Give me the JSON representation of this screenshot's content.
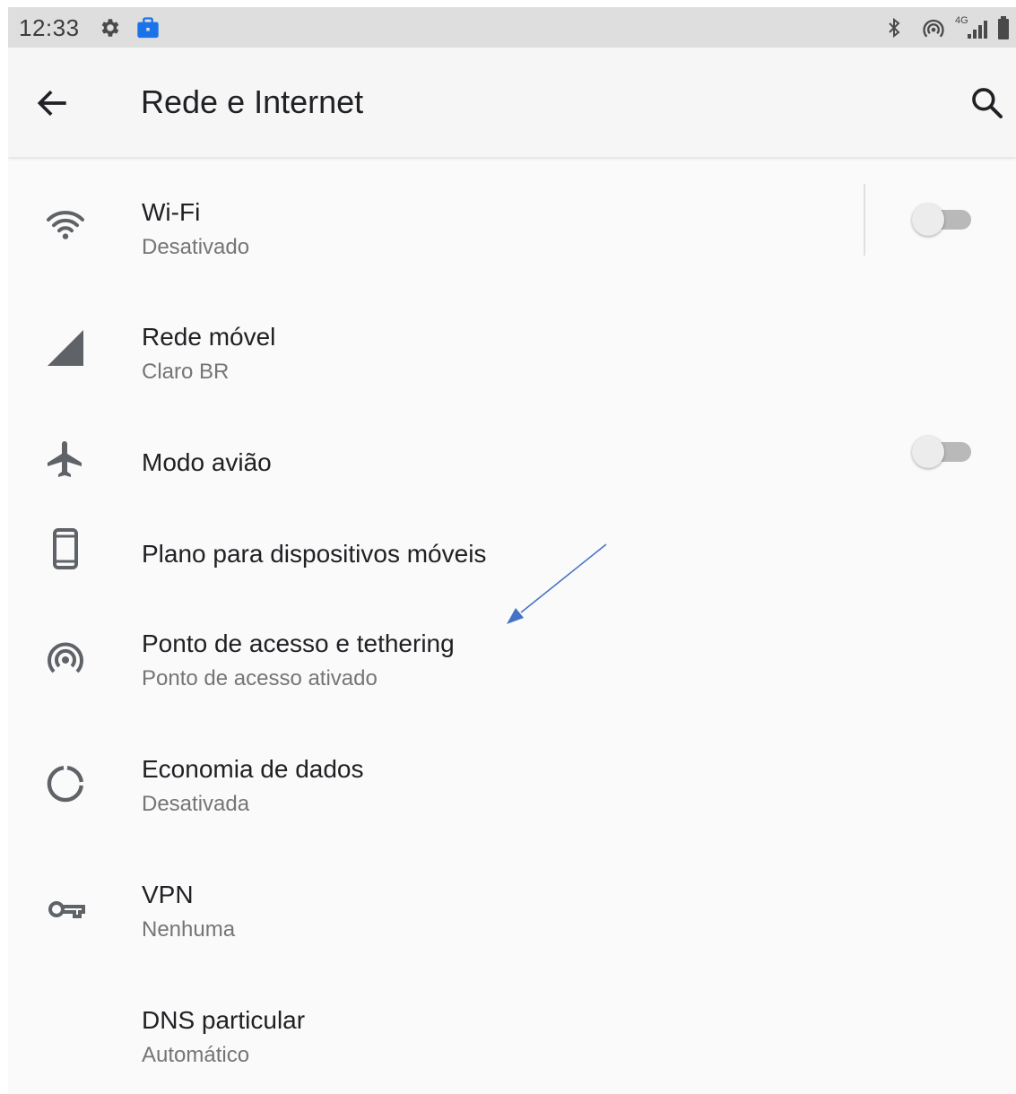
{
  "status_bar": {
    "time": "12:33",
    "icons": [
      "settings-gear-icon",
      "work-briefcase-icon",
      "bluetooth-icon",
      "hotspot-icon",
      "4g-signal-icon",
      "battery-icon"
    ],
    "network_type": "4G"
  },
  "app_bar": {
    "title": "Rede e Internet",
    "back_icon": "arrow-back-icon",
    "search_icon": "search-icon"
  },
  "settings": [
    {
      "id": "wifi",
      "title": "Wi-Fi",
      "subtitle": "Desativado",
      "icon": "wifi-icon",
      "toggle": false
    },
    {
      "id": "mobile",
      "title": "Rede móvel",
      "subtitle": "Claro BR",
      "icon": "cell-signal-icon"
    },
    {
      "id": "airplane",
      "title": "Modo avião",
      "icon": "airplane-icon",
      "toggle": false
    },
    {
      "id": "plan",
      "title": "Plano para dispositivos móveis",
      "icon": "smartphone-icon"
    },
    {
      "id": "hotspot",
      "title": "Ponto de acesso e tethering",
      "subtitle": "Ponto de acesso ativado",
      "icon": "hotspot-icon"
    },
    {
      "id": "datasaver",
      "title": "Economia de dados",
      "subtitle": "Desativada",
      "icon": "data-saver-icon"
    },
    {
      "id": "vpn",
      "title": "VPN",
      "subtitle": "Nenhuma",
      "icon": "vpn-key-icon"
    },
    {
      "id": "dns",
      "title": "DNS particular",
      "subtitle": "Automático"
    }
  ],
  "colors": {
    "annotation_arrow": "#4472c4",
    "work_badge": "#1a73e8",
    "switch_off_track": "#b9b9b9"
  }
}
